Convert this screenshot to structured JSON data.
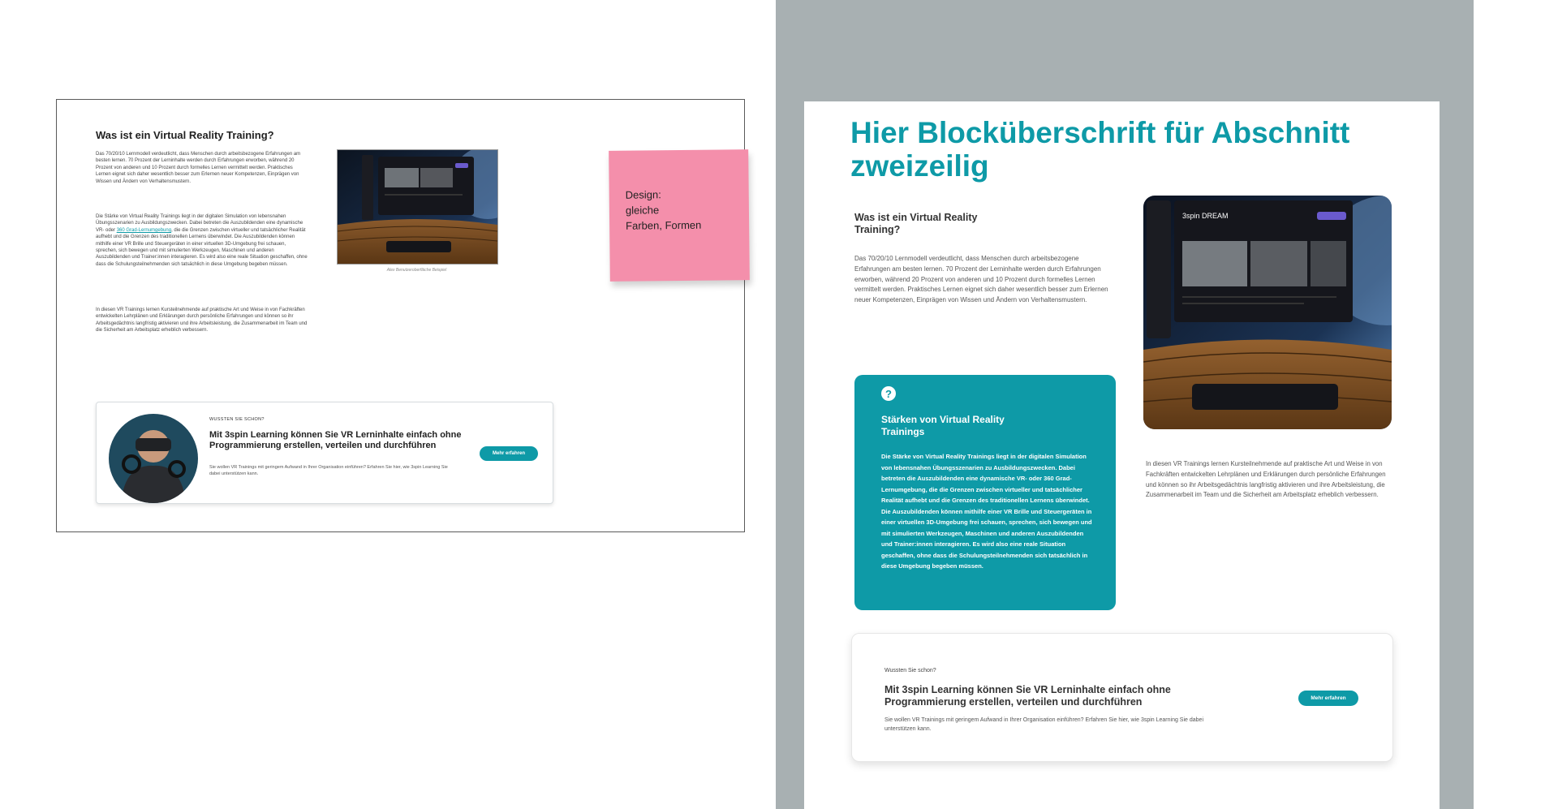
{
  "left": {
    "title": "Was ist ein Virtual Reality Training?",
    "paragraph_1": "Das 70/20/10 Lernmodell verdeutlicht, dass Menschen durch arbeitsbezogene Erfahrungen am besten lernen. 70 Prozent der Lerninhalte werden durch Erfahrungen erworben, während 20 Prozent von anderen und 10 Prozent durch formelles Lernen vermittelt werden. Praktisches Lernen eignet sich daher wesentlich besser zum Erlernen neuer Kompetenzen, Einprägen von Wissen und Ändern von Verhaltensmustern.",
    "paragraph_2_before": "Die Stärke von Virtual Reality Trainings liegt in der digitalen Simulation von lebensnahen Übungsszenarien zu Ausbildungszwecken. Dabei betreten die Auszubildenden eine dynamische VR- oder ",
    "paragraph_2_link": "360 Grad-Lernumgebung",
    "paragraph_2_after": ", die die Grenzen zwischen virtueller und tatsächlicher Realität aufhebt und die Grenzen des traditionellen Lernens überwindet. Die Auszubildenden können mithilfe einer VR Brille und Steuergeräten in einer virtuellen 3D-Umgebung frei schauen, sprechen, sich bewegen und mit simulierten Werkzeugen, Maschinen und anderen Auszubildenden und Trainer:innen interagieren. Es wird also eine reale Situation geschaffen, ohne dass die Schulungsteilnehmenden sich tatsächlich in diese Umgebung begeben müssen.",
    "paragraph_3": "In diesen VR Trainings lernen Kursteilnehmende auf praktische Art und Weise in von Fachkräften entwickelten Lehrplänen und Erklärungen durch persönliche Erfahrungen und können so ihr Arbeitsgedächtnis langfristig aktivieren und ihre Arbeitsleistung, die Zusammenarbeit im Team und die Sicherheit am Arbeitsplatz erheblich verbessern.",
    "image_caption": "Alex Benutzeroberfläche Beispiel",
    "card": {
      "kicker": "WUSSTEN SIE SCHON?",
      "title": "Mit 3spin Learning können Sie VR Lerninhalte einfach ohne Programmierung erstellen, verteilen und durchführen",
      "text": "Sie wollen VR Trainings mit geringem Aufwand in Ihrer Organisation einführen? Erfahren Sie hier, wie 3spin Learning Sie dabei unterstützen kann.",
      "button": "Mehr erfahren"
    }
  },
  "sticky_note": {
    "line_1": "Design:",
    "line_2": "gleiche",
    "line_3": "Farben, Formen"
  },
  "right": {
    "heading": "Hier Blocküberschrift für Abschnitt zweizeilig",
    "subheading": "Was ist ein Virtual Reality Training?",
    "paragraph_1": "Das 70/20/10 Lernmodell verdeutlicht, dass Menschen durch arbeitsbezogene Erfahrungen am besten lernen. 70 Prozent der Lerninhalte werden durch Erfahrungen erworben, während 20 Prozent von anderen und 10 Prozent durch formelles Lernen vermittelt werden. Praktisches Lernen eignet sich daher wesentlich besser zum Erlernen neuer Kompetenzen, Einprägen von Wissen und Ändern von Verhaltensmustern.",
    "teal_box": {
      "icon_glyph": "?",
      "title": "Stärken von Virtual Reality Trainings",
      "text": "Die Stärke von Virtual Reality Trainings liegt in der digitalen Simulation von lebensnahen Übungsszenarien zu Ausbildungszwecken. Dabei betreten die Auszubildenden eine dynamische VR- oder 360 Grad-Lernumgebung, die die Grenzen zwischen virtueller und tatsächlicher Realität aufhebt und die Grenzen des traditionellen Lernens überwindet. Die Auszubildenden können mithilfe einer VR Brille und Steuergeräten in einer virtuellen 3D-Umgebung frei schauen, sprechen, sich bewegen und mit simulierten Werkzeugen, Maschinen und anderen Auszubildenden und Trainer:innen interagieren. Es wird also eine reale Situation geschaffen, ohne dass die Schulungsteilnehmenden sich tatsächlich in diese Umgebung begeben müssen."
    },
    "paragraph_3": "In diesen VR Trainings lernen Kursteilnehmende auf praktische Art und Weise in von Fachkräften entwickelten Lehrplänen und Erklärungen durch persönliche Erfahrungen und können so ihr Arbeitsgedächtnis langfristig aktivieren und ihre Arbeitsleistung, die Zusammenarbeit im Team und die Sicherheit am Arbeitsplatz erheblich verbessern.",
    "card": {
      "kicker": "Wussten Sie schon?",
      "title": "Mit 3spin Learning können Sie VR Lerninhalte einfach ohne Programmierung erstellen, verteilen und durchführen",
      "text": "Sie wollen VR Trainings mit geringem Aufwand in Ihrer Organisation einführen? Erfahren Sie hier, wie 3spin Learning Sie dabei unterstützen kann.",
      "button": "Mehr erfahren"
    },
    "vr_panel_title": "3spin DREAM"
  },
  "colors": {
    "accent": "#0e9aa7",
    "sticky": "#f48fab",
    "backdrop": "#a8b0b2"
  }
}
